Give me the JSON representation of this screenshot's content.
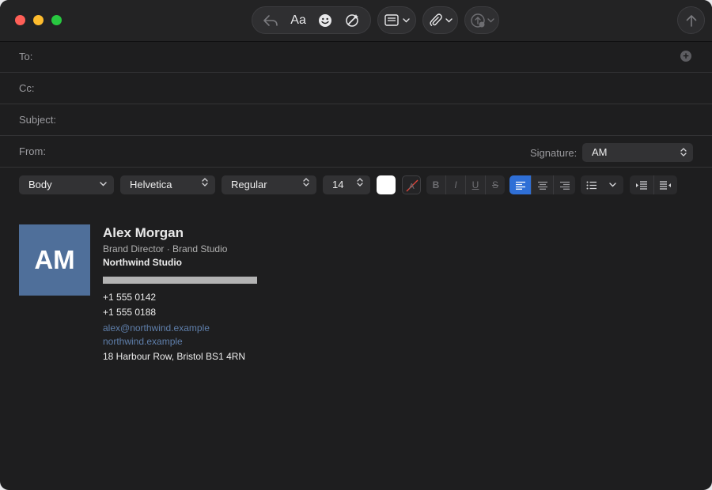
{
  "toolbar": {
    "format_label": "Aa",
    "icons": [
      "reply-icon",
      "emoji-icon",
      "writing-tools-icon",
      "header-view-icon",
      "paperclip-icon",
      "photo-browser-icon",
      "send-icon"
    ]
  },
  "headers": {
    "to_label": "To:",
    "cc_label": "Cc:",
    "subject_label": "Subject:",
    "from_label": "From:",
    "signature_label": "Signature:",
    "signature_value": "AM"
  },
  "format_bar": {
    "paragraph_style": "Body",
    "font_family": "Helvetica",
    "font_weight": "Regular",
    "font_size": "14",
    "bold": "B",
    "italic": "I",
    "underline": "U",
    "strikethrough": "S",
    "active_alignment": "left",
    "text_color": "#ffffff"
  },
  "signature": {
    "initials": "AM",
    "name": "Alex Morgan",
    "role": "Brand Director · Brand Studio",
    "company": "Northwind Studio",
    "phone_1": "+1 555 0142",
    "phone_2": "+1 555 0188",
    "email": "alex@northwind.example",
    "website": "northwind.example",
    "address": "18 Harbour Row, Bristol BS1 4RN",
    "avatar_color": "#4f6f9a",
    "link_color": "#5f7fab"
  },
  "colors": {
    "accent": "#2f6fd6",
    "window_bg": "#1e1e1f"
  }
}
